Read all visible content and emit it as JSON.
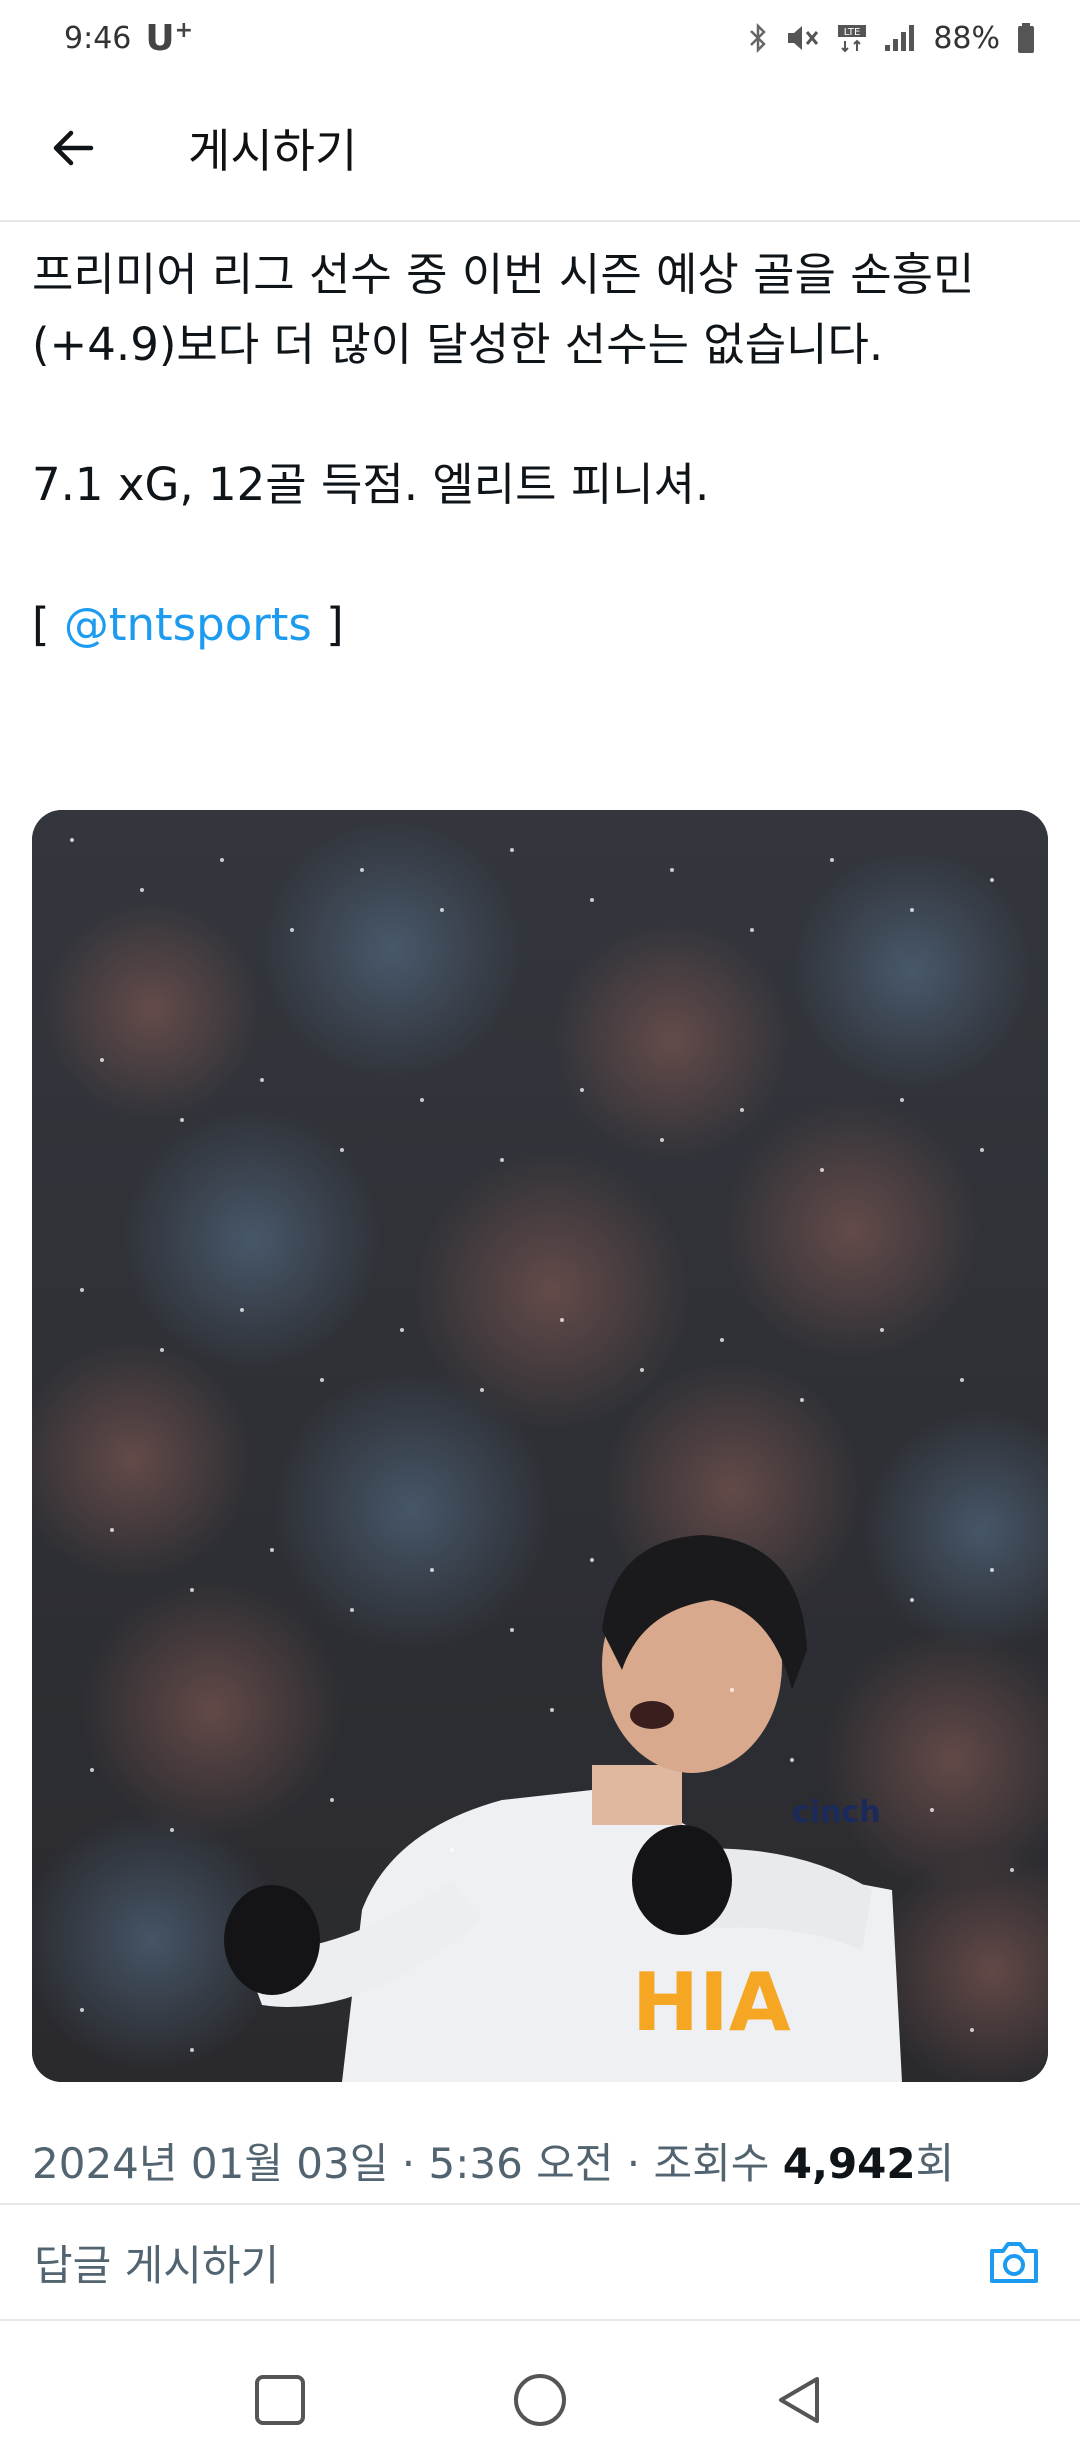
{
  "status_bar": {
    "time": "9:46",
    "carrier": "U",
    "carrier_sup": "+",
    "battery": "88%"
  },
  "header": {
    "title": "게시하기"
  },
  "post": {
    "paragraph1": "프리미어 리그 선수 중 이번 시즌 예상 골을 손흥민(+4.9)보다 더 많이 달성한 선수는 없습니다.",
    "paragraph2": "7.1 xG, 12골 득점. 엘리트 피니셔.",
    "bracket_open": "[ ",
    "mention": "@tntsports",
    "bracket_close": " ]"
  },
  "meta": {
    "date": "2024년 01월 03일",
    "separator1": " · ",
    "time": "5:36 오전",
    "separator2": " · ",
    "views_label": "조회수 ",
    "views_count": "4,942",
    "views_suffix": "회"
  },
  "reply": {
    "placeholder": "답글 게시하기"
  },
  "colors": {
    "accent": "#1d9bf0",
    "muted": "#536471"
  },
  "icons": {
    "back": "arrow-left-icon",
    "camera": "camera-icon",
    "nav_recent": "square-icon",
    "nav_home": "circle-icon",
    "nav_back": "triangle-back-icon"
  }
}
